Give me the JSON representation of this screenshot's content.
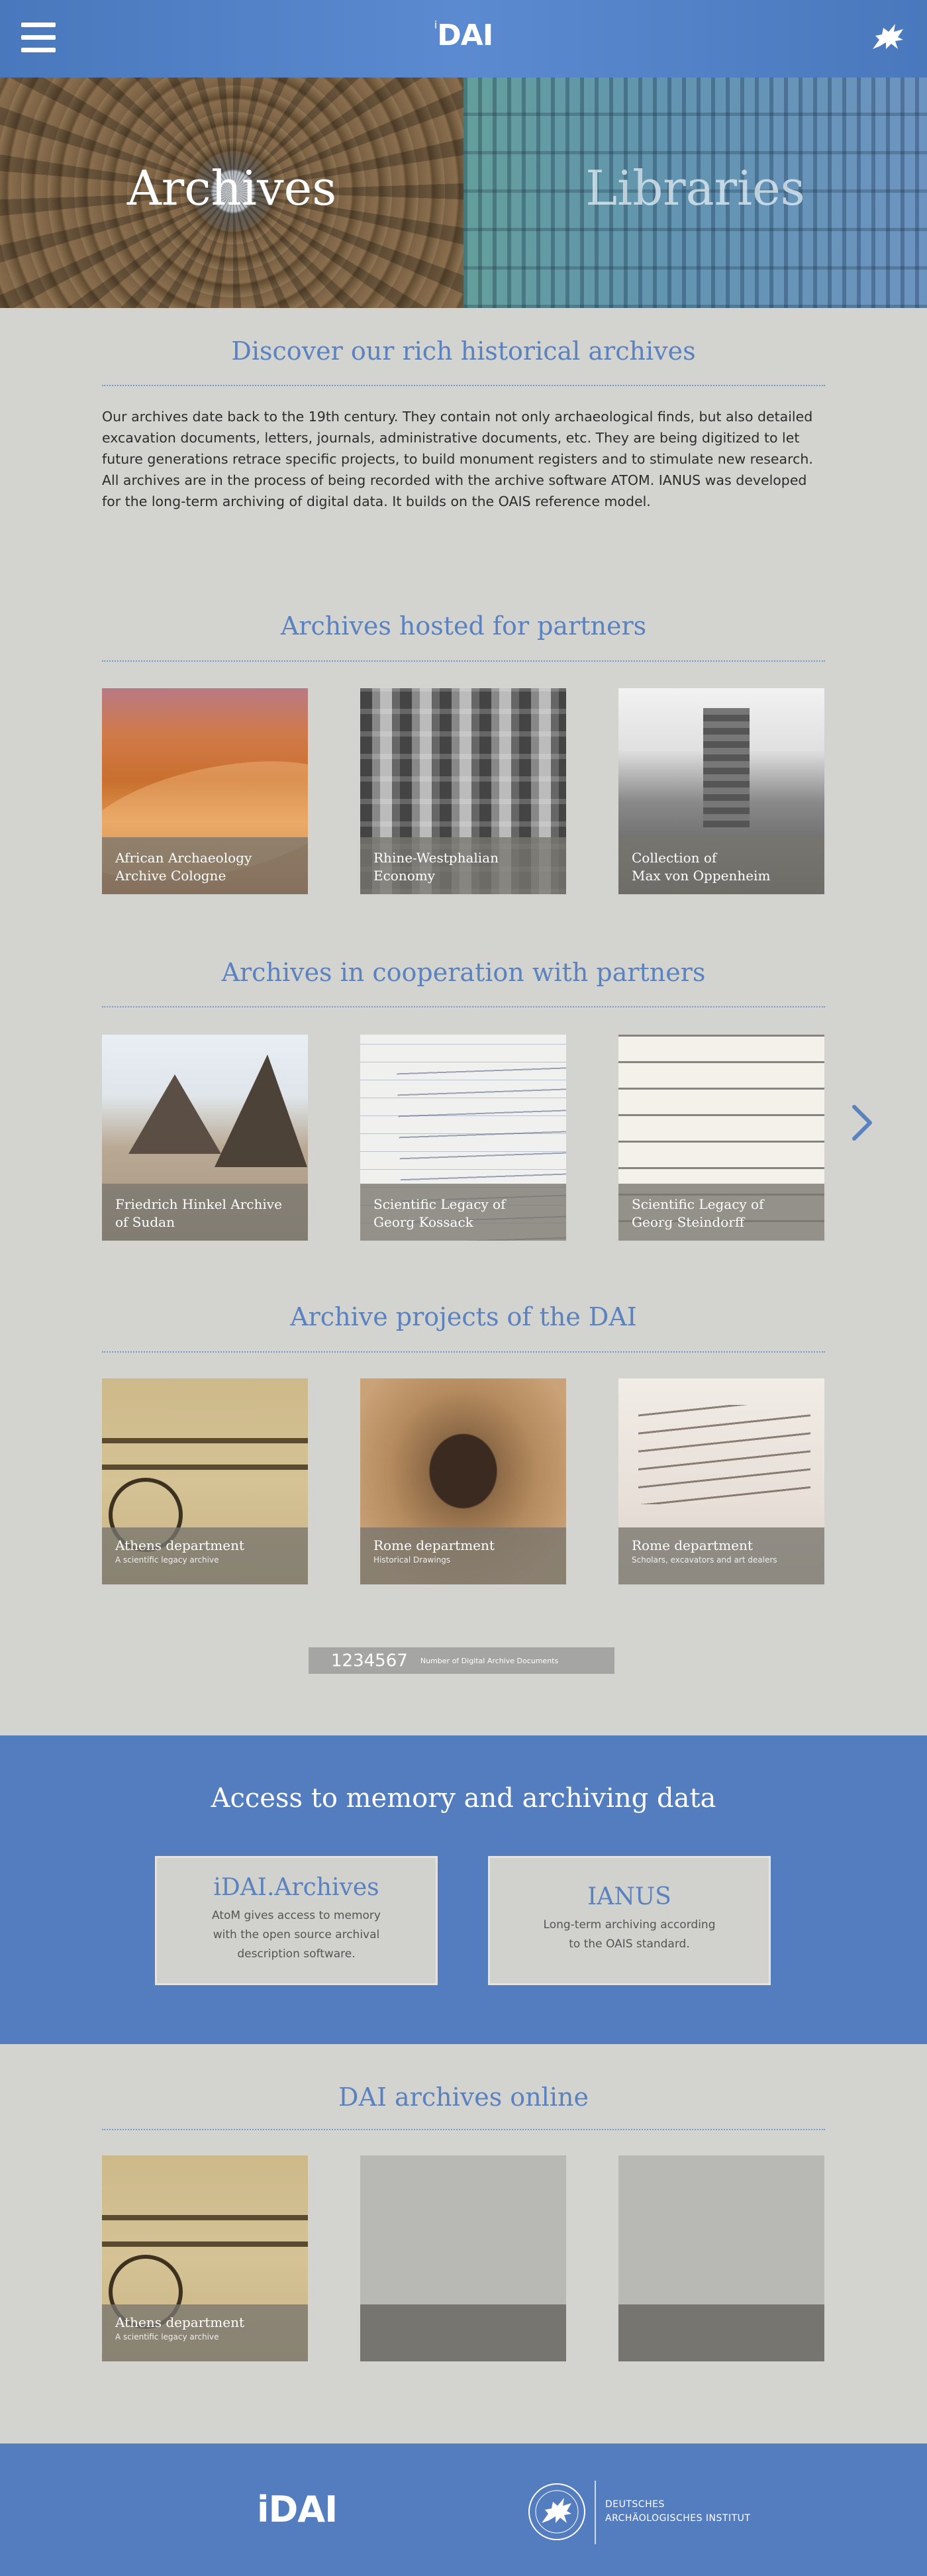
{
  "header": {
    "logo_prefix": "i",
    "logo_text": "DAI",
    "menu_icon": "hamburger-menu-icon",
    "brand_icon": "griffin-icon"
  },
  "hero": {
    "left_label": "Archives",
    "right_label": "Libraries"
  },
  "discover": {
    "title": "Discover our rich historical archives",
    "text": "Our archives date back to the 19th century. They contain not only archaeological finds, but also detailed excavation documents, letters, journals, administrative documents, etc. They are being digitized to let future generations retrace specific projects, to build monument registers and to stimulate new research. All archives are in the process of being recorded with the archive software ATOM. IANUS was developed for the long-term archiving of digital data. It builds on the OAIS reference model."
  },
  "hosted": {
    "title": "Archives hosted for partners",
    "cards": [
      {
        "line1": "African Archaeology",
        "line2": "Archive Cologne"
      },
      {
        "line1": "Rhine-Westphalian",
        "line2": "Economy"
      },
      {
        "line1": "Collection of",
        "line2": "Max von Oppenheim"
      }
    ]
  },
  "cooperation": {
    "title": "Archives in cooperation with partners",
    "cards": [
      {
        "line1": "Friedrich Hinkel Archive",
        "line2": "of Sudan"
      },
      {
        "line1": "Scientific Legacy of",
        "line2": "Georg Kossack"
      },
      {
        "line1": "Scientific Legacy of",
        "line2": "Georg Steindorff"
      }
    ],
    "next_icon": "chevron-right-icon"
  },
  "projects": {
    "title": "Archive projects of the DAI",
    "cards": [
      {
        "title": "Athens department",
        "sub": "A scientific legacy archive"
      },
      {
        "title": "Rome department",
        "sub": "Historical Drawings"
      },
      {
        "title": "Rome department",
        "sub": "Scholars, excavators and art dealers"
      }
    ]
  },
  "counter": {
    "number": "1234567",
    "label": "Number of Digital Archive Documents"
  },
  "access": {
    "title": "Access to memory and archiving data",
    "boxes": [
      {
        "title": "iDAI.Archives",
        "line1": "AtoM gives access to memory",
        "line2": "with the open source archival",
        "line3": "description software."
      },
      {
        "title": "IANUS",
        "line1": "Long-term archiving according",
        "line2": "to the OAIS standard.",
        "line3": ""
      }
    ]
  },
  "online": {
    "title": "DAI archives online",
    "cards": [
      {
        "title": "Athens department",
        "sub": "A scientific legacy archive"
      }
    ]
  },
  "footer": {
    "logo_prefix": "i",
    "logo_text": "DAI",
    "institute_line1": "DEUTSCHES",
    "institute_line2": "ARCHÄOLOGISCHES INSTITUT"
  },
  "colors": {
    "brand_blue": "#547dbf",
    "title_blue": "#5a82c1",
    "page_bg": "#d3d3cf"
  }
}
